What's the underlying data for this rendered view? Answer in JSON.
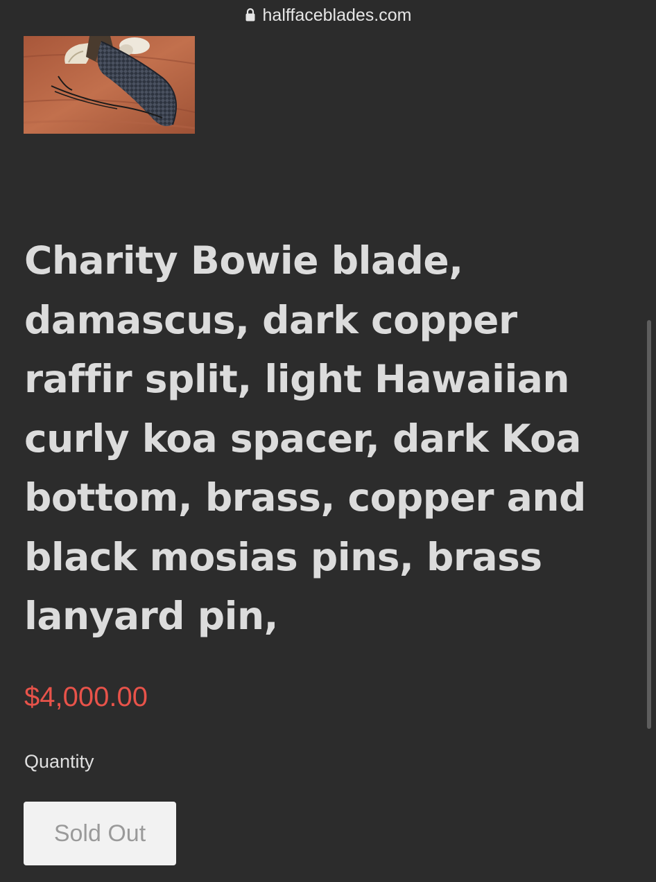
{
  "browser": {
    "url": "halffaceblades.com",
    "lock_icon": "lock-icon"
  },
  "product": {
    "thumbnail_alt": "Bowie knife in leather sheath on wooden table",
    "title": "Charity Bowie blade, damascus, dark copper raffir split, light Hawaiian curly koa spacer, dark Koa bottom, brass, copper and black mosias pins, brass lanyard pin,",
    "price": "$4,000.00",
    "quantity_label": "Quantity",
    "sold_out_label": "Sold Out"
  },
  "colors": {
    "background": "#2c2c2c",
    "title_text": "#dcdcdc",
    "price": "#e8534a",
    "button_bg": "#f2f2f2",
    "button_text": "#9a9a9a"
  }
}
